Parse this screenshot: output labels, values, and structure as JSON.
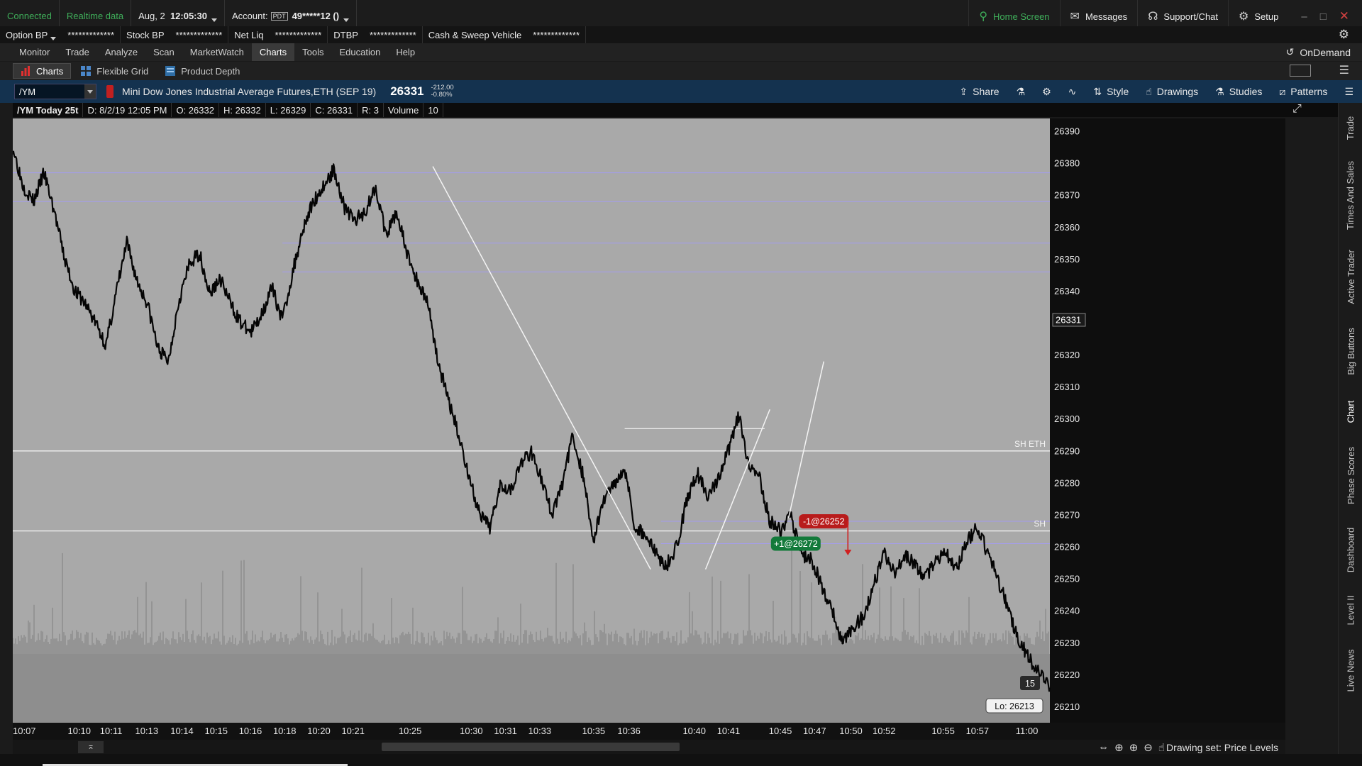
{
  "status": {
    "connection": "Connected",
    "data_mode": "Realtime data",
    "date": "Aug, 2",
    "time": "12:05:30",
    "account_label": "Account:",
    "account_badge": "PDT",
    "account_number": "49*****12 ()",
    "home_screen": "Home Screen",
    "messages": "Messages",
    "support": "Support/Chat",
    "setup": "Setup"
  },
  "balances": [
    {
      "label": "Option BP",
      "value": "*************"
    },
    {
      "label": "Stock BP",
      "value": "*************"
    },
    {
      "label": "Net Liq",
      "value": "*************"
    },
    {
      "label": "DTBP",
      "value": "*************"
    },
    {
      "label": "Cash & Sweep Vehicle",
      "value": "*************"
    }
  ],
  "menu": [
    "Monitor",
    "Trade",
    "Analyze",
    "Scan",
    "MarketWatch",
    "Charts",
    "Tools",
    "Education",
    "Help"
  ],
  "menu_active": "Charts",
  "ondemand": "OnDemand",
  "subtabs": [
    "Charts",
    "Flexible Grid",
    "Product Depth"
  ],
  "symbol": {
    "ticker": "/YM",
    "description": "Mini Dow Jones Industrial Average Futures,ETH (SEP 19)",
    "last": "26331",
    "change": "-212.00",
    "change_pct": "-0.80%"
  },
  "chart_tools": [
    "Share",
    "Style",
    "Drawings",
    "Studies",
    "Patterns"
  ],
  "info": {
    "label": "/YM Today 25t",
    "date": "D: 8/2/19 12:05 PM",
    "open": "O: 26332",
    "high": "H: 26332",
    "low": "L: 26329",
    "close": "C: 26331",
    "range": "R: 3",
    "volume_label": "Volume",
    "volume": "10"
  },
  "sidebar_tabs": [
    "Trade",
    "Times And Sales",
    "Active Trader",
    "Big Buttons",
    "Chart",
    "Phase Scores",
    "Dashboard",
    "Level II",
    "Live News"
  ],
  "sidebar_active": "Chart",
  "bottom": {
    "collapse": "⌅",
    "drawing_set": "Drawing set: Price Levels"
  },
  "chart_data": {
    "type": "line",
    "ylim": [
      26205,
      26394
    ],
    "yticks": [
      26390,
      26380,
      26370,
      26360,
      26350,
      26340,
      26330,
      26320,
      26310,
      26300,
      26290,
      26280,
      26270,
      26260,
      26250,
      26240,
      26230,
      26220,
      26210
    ],
    "current_price": "26331",
    "low_label": "Lo: 26213",
    "volume_label": "15",
    "xticks": [
      {
        "label": "10:07",
        "i": 0.0
      },
      {
        "label": "10:10",
        "i": 0.053
      },
      {
        "label": "10:11",
        "i": 0.084
      },
      {
        "label": "10:13",
        "i": 0.118
      },
      {
        "label": "10:14",
        "i": 0.152
      },
      {
        "label": "10:15",
        "i": 0.185
      },
      {
        "label": "10:16",
        "i": 0.218
      },
      {
        "label": "10:18",
        "i": 0.251
      },
      {
        "label": "10:20",
        "i": 0.284
      },
      {
        "label": "10:21",
        "i": 0.317
      },
      {
        "label": "10:25",
        "i": 0.372
      },
      {
        "label": "10:30",
        "i": 0.431
      },
      {
        "label": "10:31",
        "i": 0.464
      },
      {
        "label": "10:33",
        "i": 0.497
      },
      {
        "label": "10:35",
        "i": 0.549
      },
      {
        "label": "10:36",
        "i": 0.583
      },
      {
        "label": "10:40",
        "i": 0.646
      },
      {
        "label": "10:41",
        "i": 0.679
      },
      {
        "label": "10:45",
        "i": 0.729
      },
      {
        "label": "10:47",
        "i": 0.762
      },
      {
        "label": "10:50",
        "i": 0.797
      },
      {
        "label": "10:52",
        "i": 0.829
      },
      {
        "label": "10:55",
        "i": 0.886
      },
      {
        "label": "10:57",
        "i": 0.919
      },
      {
        "label": "11:00",
        "i": 0.967
      }
    ],
    "series": [
      {
        "values": [
          26385,
          26373,
          26368,
          26377,
          26365,
          26350,
          26340,
          26336,
          26330,
          26323,
          26340,
          26355,
          26343,
          26336,
          26322,
          26318,
          26337,
          26348,
          26352,
          26339,
          26344,
          26336,
          26330,
          26327,
          26333,
          26341,
          26331,
          26346,
          26360,
          26368,
          26373,
          26378,
          26366,
          26362,
          26365,
          26373,
          26357,
          26365,
          26352,
          26343,
          26337,
          26318,
          26306,
          26295,
          26282,
          26270,
          26266,
          26280,
          26278,
          26286,
          26290,
          26281,
          26270,
          26280,
          26295,
          26282,
          26262,
          26275,
          26280,
          26285,
          26266,
          26264,
          26258,
          26254,
          26260,
          26275,
          26283,
          26276,
          26281,
          26290,
          26301,
          26284,
          26282,
          26268,
          26265,
          26270,
          26258,
          26256,
          26248,
          26240,
          26230,
          26235,
          26238,
          26248,
          26258,
          26252,
          26257,
          26255,
          26250,
          26256,
          26258,
          26253,
          26262,
          26266,
          26258,
          26250,
          26240,
          26231,
          26225,
          26220,
          26216
        ]
      }
    ],
    "price_lines": [
      {
        "price": 26377,
        "from": 0.0
      },
      {
        "price": 26368,
        "from": 0.0
      },
      {
        "price": 26355,
        "from": 0.26
      },
      {
        "price": 26346,
        "from": 0.26
      },
      {
        "price": 26297,
        "from": 0.59,
        "to": 0.725
      },
      {
        "price": 26268,
        "from": 0.625
      },
      {
        "price": 26261,
        "from": 0.625
      }
    ],
    "reference_lines": [
      {
        "price": 26290,
        "label": "SH ETH"
      },
      {
        "price": 26265,
        "label": "SH"
      }
    ],
    "orders": [
      {
        "label": "-1@26252",
        "price": 26268,
        "at": 0.782,
        "color": "#b81c1c"
      },
      {
        "label": "+1@26272",
        "price": 26261,
        "at": 0.755,
        "color": "#137a3a"
      }
    ]
  }
}
